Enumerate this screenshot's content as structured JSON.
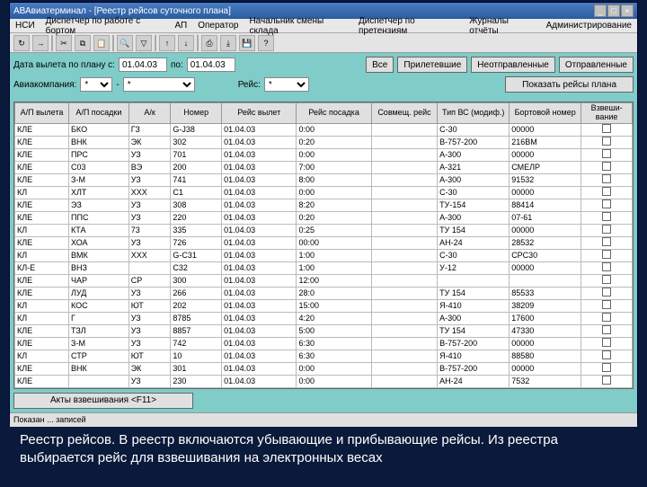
{
  "title": "АВАвиатерминал - [Реестр рейсов суточного плана]",
  "menu": [
    "НСИ",
    "Диспетчер по работе с бортом",
    "АП",
    "Оператор",
    "Начальник смены склада",
    "Диспетчер по претензиям",
    "Журналы отчёты",
    "Администрирование"
  ],
  "filters": {
    "date_from_lbl": "Дата вылета по плану с:",
    "date_from": "01.04.03",
    "date_to_lbl": "по:",
    "date_to": "01.04.03",
    "btn_all": "Все",
    "btn_arr": "Прилетевшие",
    "btn_nodep": "Неотправленные",
    "btn_dep": "Отправленные",
    "airline_lbl": "Авиакомпания:",
    "airline1": "*",
    "airline2": "*",
    "flight_lbl": "Рейс:",
    "flight": "*",
    "btn_show": "Показать рейсы плана"
  },
  "headers": [
    "А/П вылета",
    "А/П посадки",
    "А/к",
    "Номер",
    "Рейс вылет",
    "Рейс посадка",
    "Совмещ. рейс",
    "Тип ВС (модиф.)",
    "Бортовой номер",
    "Взвеши-вание"
  ],
  "colw": [
    "36",
    "40",
    "28",
    "34",
    "50",
    "50",
    "44",
    "48",
    "48",
    "34"
  ],
  "rows": [
    [
      "КЛЕ",
      "БКО",
      "ГЗ",
      "G-J38",
      "01.04.03",
      "0:00",
      "",
      "С-30",
      "00000",
      ""
    ],
    [
      "КЛЕ",
      "ВНК",
      "ЭК",
      "302",
      "01.04.03",
      "0:20",
      "",
      "В-757-200",
      "216ВМ",
      ""
    ],
    [
      "КЛЕ",
      "ПРС",
      "УЗ",
      "701",
      "01.04.03",
      "0:00",
      "",
      "А-300",
      "00000",
      ""
    ],
    [
      "КЛЕ",
      "С03",
      "ВЭ",
      "200",
      "01.04.03",
      "7:00",
      "",
      "А-321",
      "СМЕЛР",
      ""
    ],
    [
      "КЛЕ",
      "З-М",
      "УЗ",
      "741",
      "01.04.03",
      "8:00",
      "",
      "А-300",
      "91532",
      ""
    ],
    [
      "КЛ",
      "ХЛТ",
      "ХХХ",
      "С1",
      "01.04.03",
      "0:00",
      "",
      "С-30",
      "00000",
      ""
    ],
    [
      "КЛЕ",
      "ЭЗ",
      "УЗ",
      "308",
      "01.04.03",
      "8:20",
      "",
      "ТУ-154",
      "88414",
      ""
    ],
    [
      "КЛЕ",
      "ППС",
      "УЗ",
      "220",
      "01.04.03",
      "0:20",
      "",
      "А-300",
      "07-61",
      ""
    ],
    [
      "КЛ",
      "КТА",
      "73",
      "335",
      "01.04.03",
      "0:25",
      "",
      "ТУ 154",
      "00000",
      ""
    ],
    [
      "КЛЕ",
      "ХОА",
      "УЗ",
      "726",
      "01.04.03",
      "00:00",
      "",
      "АН-24",
      "28532",
      ""
    ],
    [
      "КЛ",
      "ВМК",
      "ХХХ",
      "G-С31",
      "01.04.03",
      "1:00",
      "",
      "С-30",
      "СРС30",
      ""
    ],
    [
      "КЛ-Е",
      "ВНЗ",
      "",
      "С32",
      "01.04.03",
      "1:00",
      "",
      "У-12",
      "00000",
      ""
    ],
    [
      "КЛЕ",
      "ЧАР",
      "СР",
      "300",
      "01.04.03",
      "12:00",
      "",
      "",
      "",
      ""
    ],
    [
      "КЛЕ",
      "ЛУД",
      "УЗ",
      "266",
      "01.04.03",
      "28:0",
      "",
      "ТУ 154",
      "85533",
      ""
    ],
    [
      "КЛ",
      "КОС",
      "ЮТ",
      "202",
      "01.04.03",
      "15:00",
      "",
      "Я-410",
      "38209",
      ""
    ],
    [
      "КЛ",
      "Г",
      "УЗ",
      "8785",
      "01.04.03",
      "4:20",
      "",
      "А-300",
      "17600",
      ""
    ],
    [
      "КЛЕ",
      "ТЗЛ",
      "УЗ",
      "8857",
      "01.04.03",
      "5:00",
      "",
      "ТУ 154",
      "47330",
      ""
    ],
    [
      "КЛЕ",
      "З-М",
      "УЗ",
      "742",
      "01.04.03",
      "6:30",
      "",
      "В-757-200",
      "00000",
      ""
    ],
    [
      "КЛ",
      "СТР",
      "ЮТ",
      "10",
      "01.04.03",
      "6:30",
      "",
      "Я-410",
      "88580",
      ""
    ],
    [
      "КЛЕ",
      "ВНК",
      "ЭК",
      "301",
      "01.04.03",
      "0:00",
      "",
      "В-757-200",
      "00000",
      ""
    ],
    [
      "КЛЕ",
      "",
      "УЗ",
      "230",
      "01.04.03",
      "0:00",
      "",
      "АН-24",
      "7532",
      ""
    ]
  ],
  "footer_btn": "Акты взвешивания <F11>",
  "status": "Показан ... записей",
  "caption": "Реестр рейсов. В реестр включаются убывающие и прибывающие рейсы. Из реестра выбирается рейс для взвешивания на электронных весах"
}
